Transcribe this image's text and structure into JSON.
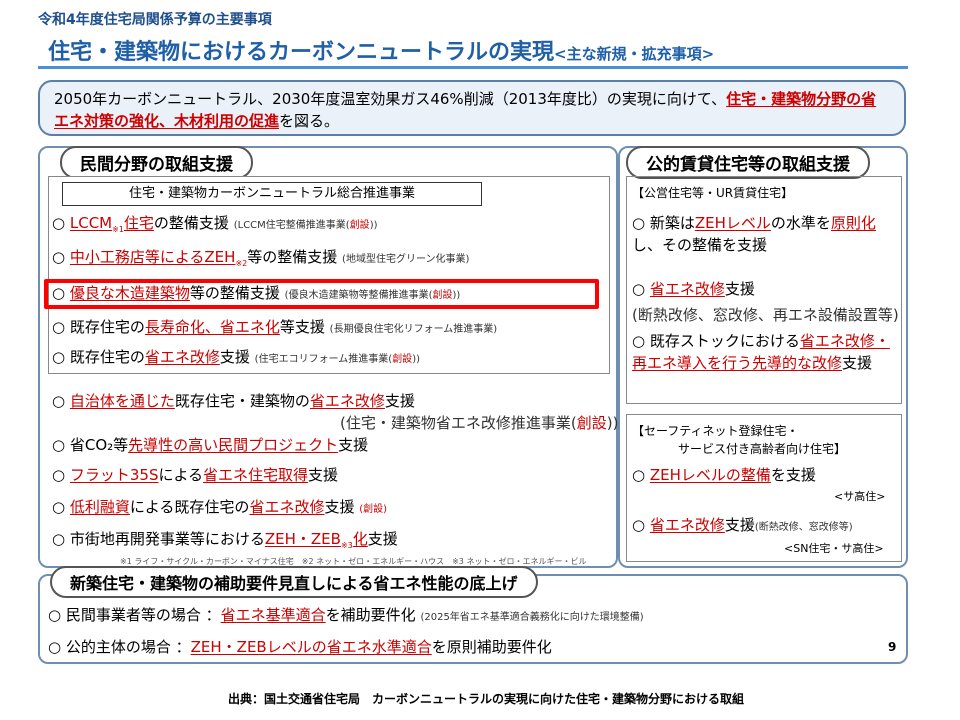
{
  "header": {
    "top": "令和4年度住宅局関係予算の主要事項",
    "title": "住宅・建築物におけるカーボンニュートラルの実現",
    "title_sub": "<主な新規・拡充事項>"
  },
  "summary": {
    "pre": "2050年カーボンニュートラル、2030年度温室効果ガス46%削減（2013年度比）の実現に向けて、",
    "highlight": "住宅・建築物分野の省エネ対策の強化、木材利用の促進",
    "post": "を図る。"
  },
  "left": {
    "pill": "民間分野の取組支援",
    "program_header": "住宅・建築物カーボンニュートラル総合推進事業",
    "items": [
      {
        "pre": "○ ",
        "hl": "LCCM",
        "sup": "※1",
        "hl2": "住宅",
        "post": "の整備支援",
        "note": "(LCCM住宅整備推進事業(",
        "note_red": "創設",
        "note_end": "))"
      },
      {
        "pre": "○ ",
        "hl": "中小工務店等によるZEH",
        "sup": "※2",
        "post": "等の整備支援",
        "note": "(地域型住宅グリーン化事業)"
      },
      {
        "pre": "○ ",
        "hl": "優良な木造建築物",
        "post": "等の整備支援",
        "note": "(優良木造建築物等整備推進事業(",
        "note_red": "創設",
        "note_end": "))"
      },
      {
        "pre": "○ 既存住宅の",
        "hl": "長寿命化、省エネ化",
        "post": "等支援",
        "note": "(長期優良住宅化リフォーム推進事業)"
      },
      {
        "pre": "○ 既存住宅の",
        "hl": "省エネ改修",
        "post": "支援",
        "note": "(住宅エコリフォーム推進事業(",
        "note_red": "創設",
        "note_end": "))"
      }
    ],
    "items2": [
      {
        "pre": "○ ",
        "hl": "自治体を通じた",
        "mid": "既存住宅・建築物の",
        "hl2": "省エネ改修",
        "post": "支援",
        "note": "(住宅・建築物省エネ改修推進事業(",
        "note_red": "創設",
        "note_end": "))"
      },
      {
        "pre": "○ 省CO₂等",
        "hl": "先導性の高い民間プロジェクト",
        "post": "支援"
      },
      {
        "pre": "○ ",
        "hl": "フラット35S",
        "mid": "による",
        "hl2": "省エネ住宅取得",
        "post": "支援"
      },
      {
        "pre": "○ ",
        "hl": "低利融資",
        "mid": "による既存住宅の",
        "hl2": "省エネ改修",
        "post": "支援",
        "note_red": "(創設)"
      },
      {
        "pre": "○ 市街地再開発事業等における",
        "hl": "ZEH・ZEB",
        "sup": "※3",
        "hl2": "化",
        "post": "支援"
      }
    ],
    "footnote": "※1 ライフ・サイクル・カーボン・マイナス住宅　※2 ネット・ゼロ・エネルギー・ハウス　※3 ネット・ゼロ・エネルギー・ビル"
  },
  "right": {
    "pill": "公的賃貸住宅等の取組支援",
    "box1_title": "【公営住宅等・UR賃貸住宅】",
    "b1_1_pre": "○ 新築は",
    "b1_1_hl": "ZEHレベル",
    "b1_1_mid": "の水準を",
    "b1_1_hl2": "原則化",
    "b1_1_post": "し、その整備を支援",
    "b1_2_pre": "○ ",
    "b1_2_hl": "省エネ改修",
    "b1_2_post": "支援",
    "b1_2_note": "(断熱改修、窓改修、再エネ設備設置等)",
    "b1_3_pre": "○ 既存ストックにおける",
    "b1_3_hl": "省エネ改修・再エネ導入を行う先導的な改修",
    "b1_3_post": "支援",
    "box2_title1": "【セーフティネット登録住宅・",
    "box2_title2": "サービス付き高齢者向け住宅】",
    "b2_1_pre": "○ ",
    "b2_1_hl": "ZEHレベルの整備",
    "b2_1_post": "を支援",
    "b2_1_tag": "<サ高住>",
    "b2_2_pre": "○ ",
    "b2_2_hl": "省エネ改修",
    "b2_2_post": "支援",
    "b2_2_note": "(断熱改修、窓改修等)",
    "b2_2_tag": "<SN住宅・サ高住>"
  },
  "bottom": {
    "pill": "新築住宅・建築物の補助要件見直しによる省エネ性能の底上げ",
    "r1_pre": "○ 民間事業者等の場合 ：",
    "r1_hl": "省エネ基準適合",
    "r1_post": "を補助要件化",
    "r1_note": "(2025年省エネ基準適合義務化に向けた環境整備)",
    "r2_pre": "○ 公的主体の場合 ：",
    "r2_hl": "ZEH・ZEBレベルの省エネ水準適合",
    "r2_post": "を原則補助要件化"
  },
  "page_number": "9",
  "source": "出典：国土交通省住宅局　カーボンニュートラルの実現に向けた住宅・建築物分野における取組"
}
